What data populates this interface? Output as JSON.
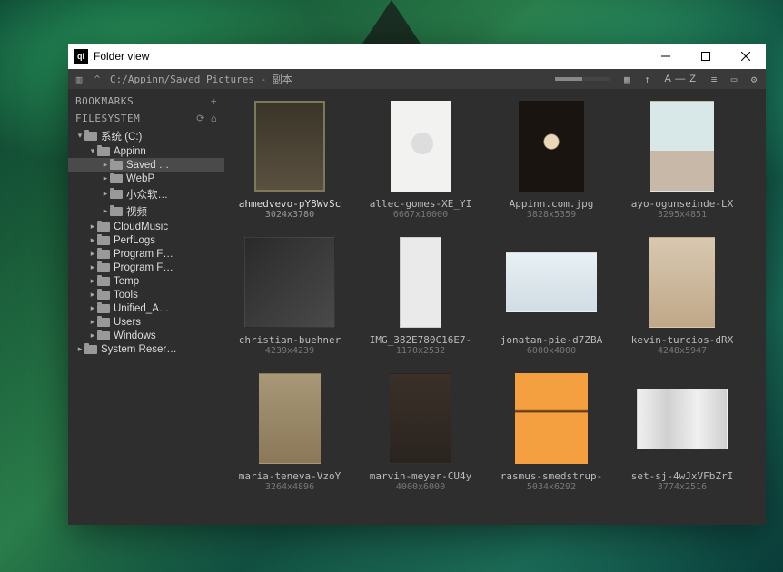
{
  "window": {
    "title": "Folder view"
  },
  "pathbar": {
    "path": "C:/Appinn/Saved Pictures - 副本",
    "sort_label": "A — Z"
  },
  "sidebar": {
    "bookmarks_label": "BOOKMARKS",
    "filesystem_label": "FILESYSTEM",
    "tree": [
      {
        "label": "系统 (C:)",
        "depth": 0,
        "arrow": "▾"
      },
      {
        "label": "Appinn",
        "depth": 1,
        "arrow": "▾"
      },
      {
        "label": "Saved …",
        "depth": 2,
        "arrow": "▸",
        "selected": true
      },
      {
        "label": "WebP",
        "depth": 2,
        "arrow": "▸"
      },
      {
        "label": "小众软…",
        "depth": 2,
        "arrow": "▸"
      },
      {
        "label": "视频",
        "depth": 2,
        "arrow": "▸"
      },
      {
        "label": "CloudMusic",
        "depth": 1,
        "arrow": "▸"
      },
      {
        "label": "PerfLogs",
        "depth": 1,
        "arrow": "▸"
      },
      {
        "label": "Program F…",
        "depth": 1,
        "arrow": "▸"
      },
      {
        "label": "Program F…",
        "depth": 1,
        "arrow": "▸"
      },
      {
        "label": "Temp",
        "depth": 1,
        "arrow": "▸"
      },
      {
        "label": "Tools",
        "depth": 1,
        "arrow": "▸"
      },
      {
        "label": "Unified_A…",
        "depth": 1,
        "arrow": "▸"
      },
      {
        "label": "Users",
        "depth": 1,
        "arrow": "▸"
      },
      {
        "label": "Windows",
        "depth": 1,
        "arrow": "▸"
      },
      {
        "label": "System Reser…",
        "depth": 0,
        "arrow": "▸"
      }
    ]
  },
  "thumbnails": [
    {
      "name": "ahmedvevo-pY8WvSc",
      "dims": "3024x3780",
      "selected": true
    },
    {
      "name": "allec-gomes-XE_YI",
      "dims": "6667x10000"
    },
    {
      "name": "Appinn.com.jpg",
      "dims": "3828x5359"
    },
    {
      "name": "ayo-ogunseinde-LX",
      "dims": "3295x4851"
    },
    {
      "name": "christian-buehner",
      "dims": "4239x4239"
    },
    {
      "name": "IMG_382E780C16E7-",
      "dims": "1170x2532"
    },
    {
      "name": "jonatan-pie-d7ZBA",
      "dims": "6000x4000"
    },
    {
      "name": "kevin-turcios-dRX",
      "dims": "4248x5947"
    },
    {
      "name": "maria-teneva-VzoY",
      "dims": "3264x4896"
    },
    {
      "name": "marvin-meyer-CU4y",
      "dims": "4000x6000"
    },
    {
      "name": "rasmus-smedstrup-",
      "dims": "5034x6292"
    },
    {
      "name": "set-sj-4wJxVFbZrI",
      "dims": "3774x2516"
    }
  ]
}
